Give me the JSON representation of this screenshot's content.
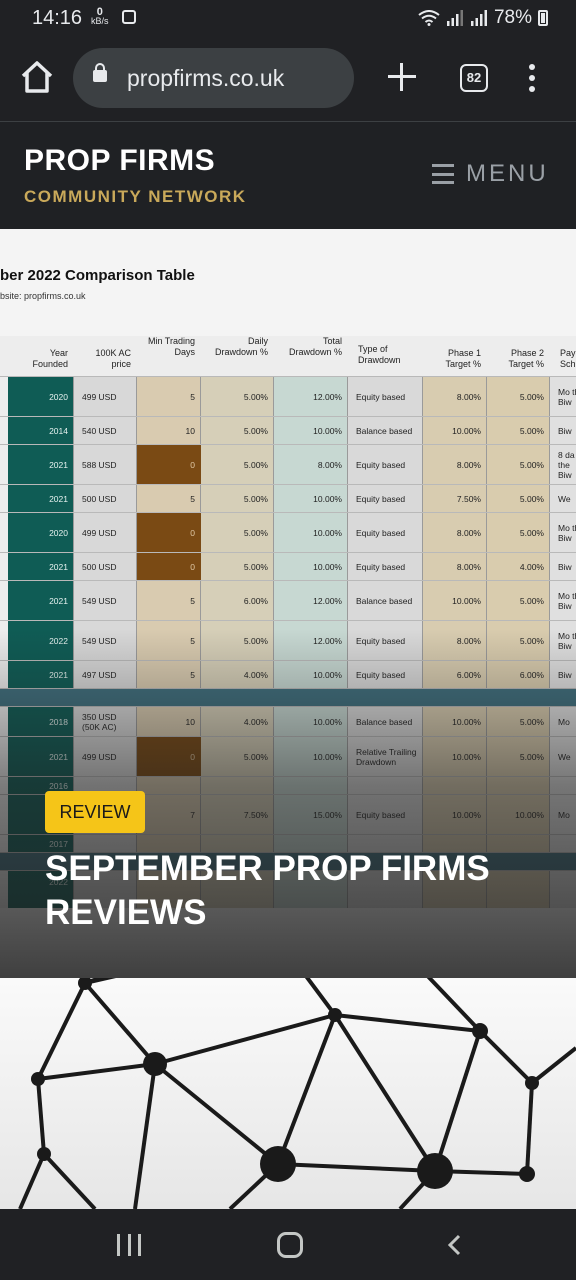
{
  "status_bar": {
    "time": "14:16",
    "net_speed_value": "0",
    "net_speed_unit": "kB/s",
    "battery": "78%"
  },
  "browser": {
    "url": "propfirms.co.uk",
    "tab_count": "82"
  },
  "site_header": {
    "title": "PROP FIRMS",
    "subtitle": "COMMUNITY NETWORK",
    "menu_label": "MENU"
  },
  "colors": {
    "accent_gold": "#c9a95a",
    "badge_yellow": "#f5c518",
    "background_dark": "#1f2124",
    "teal_column": "#0f5c55"
  },
  "featured_post": {
    "category": "REVIEW",
    "title": "SEPTEMBER PROP FIRMS REVIEWS",
    "image": {
      "table_title": "ber 2022 Comparison Table",
      "table_website": "bsite: propfirms.co.uk",
      "headers": [
        "Year Founded",
        "100K AC price",
        "Min Trading Days",
        "Daily Drawdown %",
        "Total Drawdown %",
        "Type of Drawdown",
        "Phase 1 Target %",
        "Phase 2 Target %",
        "Pay Sch"
      ],
      "rows": [
        [
          "2020",
          "499 USD",
          "5",
          "5.00%",
          "12.00%",
          "Equity based",
          "8.00%",
          "5.00%",
          "Mo the Biw"
        ],
        [
          "2014",
          "540 USD",
          "10",
          "5.00%",
          "10.00%",
          "Balance based",
          "10.00%",
          "5.00%",
          "Biw"
        ],
        [
          "2021",
          "588 USD",
          "0",
          "5.00%",
          "8.00%",
          "Equity based",
          "8.00%",
          "5.00%",
          "8 da the Biw"
        ],
        [
          "2021",
          "500 USD",
          "5",
          "5.00%",
          "10.00%",
          "Equity based",
          "7.50%",
          "5.00%",
          "We"
        ],
        [
          "2020",
          "499 USD",
          "0",
          "5.00%",
          "10.00%",
          "Equity based",
          "8.00%",
          "5.00%",
          "Mo the Biw"
        ],
        [
          "2021",
          "500 USD",
          "0",
          "5.00%",
          "10.00%",
          "Equity based",
          "8.00%",
          "4.00%",
          "Biw"
        ],
        [
          "2021",
          "549 USD",
          "5",
          "6.00%",
          "12.00%",
          "Balance based",
          "10.00%",
          "5.00%",
          "Mo the Biw"
        ],
        [
          "2022",
          "549 USD",
          "5",
          "5.00%",
          "12.00%",
          "Equity based",
          "8.00%",
          "5.00%",
          "Mo the Biw"
        ],
        [
          "2021",
          "497 USD",
          "5",
          "4.00%",
          "10.00%",
          "Equity based",
          "6.00%",
          "6.00%",
          "Biw"
        ],
        [
          "",
          "",
          "",
          "",
          "",
          "",
          "",
          "",
          ""
        ],
        [
          "2018",
          "350 USD (50K AC)",
          "10",
          "4.00%",
          "10.00%",
          "Balance based",
          "10.00%",
          "5.00%",
          "Mo"
        ],
        [
          "2021",
          "499 USD",
          "0",
          "5.00%",
          "10.00%",
          "Relative Trailing Drawdown",
          "10.00%",
          "5.00%",
          "We"
        ],
        [
          "2016",
          "",
          "",
          "",
          "",
          "",
          "",
          "",
          ""
        ],
        [
          "",
          "",
          "7",
          "7.50%",
          "15.00%",
          "Equity based",
          "10.00%",
          "10.00%",
          "Mo"
        ],
        [
          "2017",
          "",
          "",
          "",
          "",
          "",
          "",
          "",
          ""
        ],
        [
          "",
          "",
          "",
          "",
          "",
          "",
          "",
          "",
          ""
        ],
        [
          "2022",
          "",
          "",
          "",
          "",
          "",
          "",
          "",
          ""
        ]
      ]
    }
  },
  "nav_bar": {
    "recent_icon": "recent-apps-icon",
    "home_icon": "home-icon",
    "back_icon": "back-icon"
  }
}
